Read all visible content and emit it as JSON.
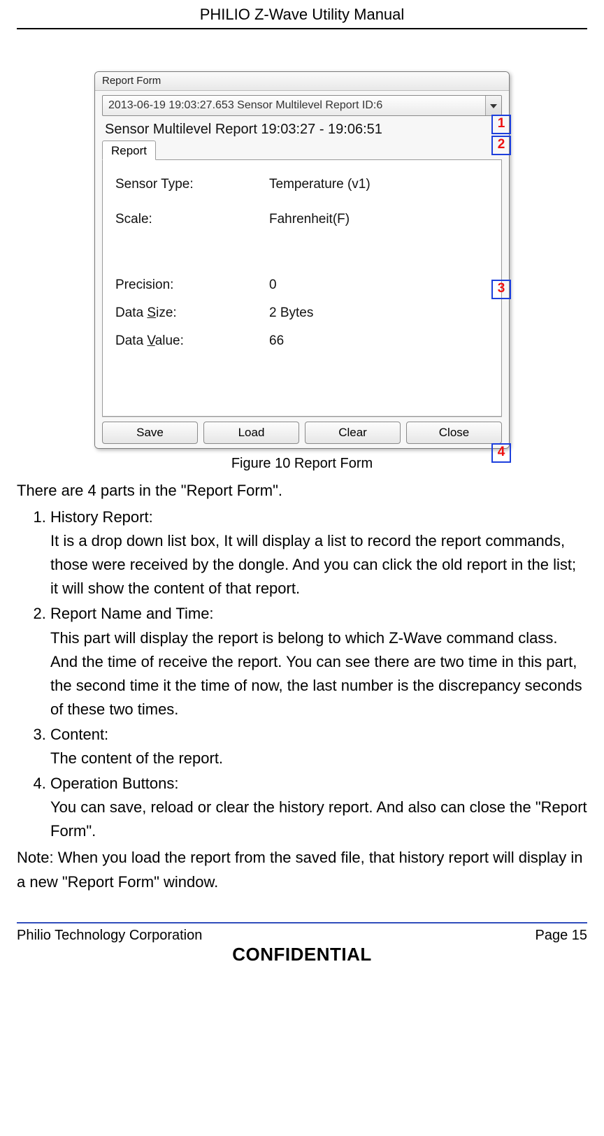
{
  "header": {
    "title": "PHILIO Z-Wave Utility Manual"
  },
  "window": {
    "title": "Report Form",
    "dropdown": {
      "text": "2013-06-19 19:03:27.653 Sensor Multilevel Report  ID:6"
    },
    "report_line": "Sensor Multilevel Report  19:03:27 - 19:06:51",
    "tab_label": "Report",
    "fields": {
      "sensor_type_lbl": "Sensor Type:",
      "sensor_type_val": "Temperature (v1)",
      "scale_lbl": "Scale:",
      "scale_val": "Fahrenheit(F)",
      "precision_lbl": "Precision:",
      "precision_val": "0",
      "size_lbl_pre": "Data ",
      "size_lbl_hk": "S",
      "size_lbl_post": "ize:",
      "size_val": "2 Bytes",
      "value_lbl_pre": "Data ",
      "value_lbl_hk": "V",
      "value_lbl_post": "alue:",
      "value_val": "66"
    },
    "buttons": {
      "save": "Save",
      "load": "Load",
      "clear": "Clear",
      "close": "Close"
    }
  },
  "callouts": {
    "c1": "1",
    "c2": "2",
    "c3": "3",
    "c4": "4"
  },
  "figure_caption": "Figure 10 Report Form",
  "body": {
    "intro": "There are 4 parts in the \"Report Form\".",
    "item1_t": "History Report:",
    "item1_b": "It is a drop down list box, It will display a list to record the report commands, those were received by the dongle. And you can click the old report in the list; it will show the content of that report.",
    "item2_t": "Report Name and Time:",
    "item2_b": "This part will display the report is belong to which Z-Wave command class. And the time of receive the report. You can see there are two time in this part, the second time it the time of now, the last number is the discrepancy seconds of these two times.",
    "item3_t": "Content:",
    "item3_b": "The content of the report.",
    "item4_t": "Operation Buttons:",
    "item4_b": "You can save, reload or clear the history report. And also can close the \"Report Form\".",
    "note": "Note: When you load the report from the saved file, that history report will display in a new \"Report Form\" window."
  },
  "footer": {
    "company": "Philio Technology Corporation",
    "page": "Page 15",
    "confidential": "CONFIDENTIAL"
  }
}
